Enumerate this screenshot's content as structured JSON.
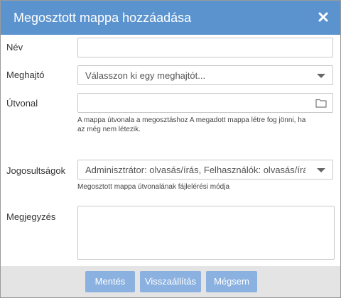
{
  "dialog": {
    "title": "Megosztott mappa hozzáadása",
    "close_icon": "close-icon"
  },
  "form": {
    "name_label": "Név",
    "name_value": "",
    "drive_label": "Meghajtó",
    "drive_placeholder": "Válasszon ki egy meghajtót...",
    "path_label": "Útvonal",
    "path_value": "",
    "path_icon": "folder-icon",
    "path_hint_line1": "A mappa útvonala a megosztáshoz A megadott mappa létre fog jönni, ha",
    "path_hint_line2": "az még nem létezik.",
    "permissions_label": "Jogosultságok",
    "permissions_value": "Adminisztrátor: olvasás/írás, Felhasználók: olvasás/írás",
    "permissions_hint": "Megosztott mappa útvonalának fájlelérési módja",
    "note_label": "Megjegyzés",
    "note_value": ""
  },
  "buttons": {
    "save": "Mentés",
    "reset": "Visszaállítás",
    "cancel": "Mégsem"
  },
  "colors": {
    "titlebar": "#5b93cf",
    "button": "#8ab1e0",
    "footer": "#e4e4e4"
  }
}
